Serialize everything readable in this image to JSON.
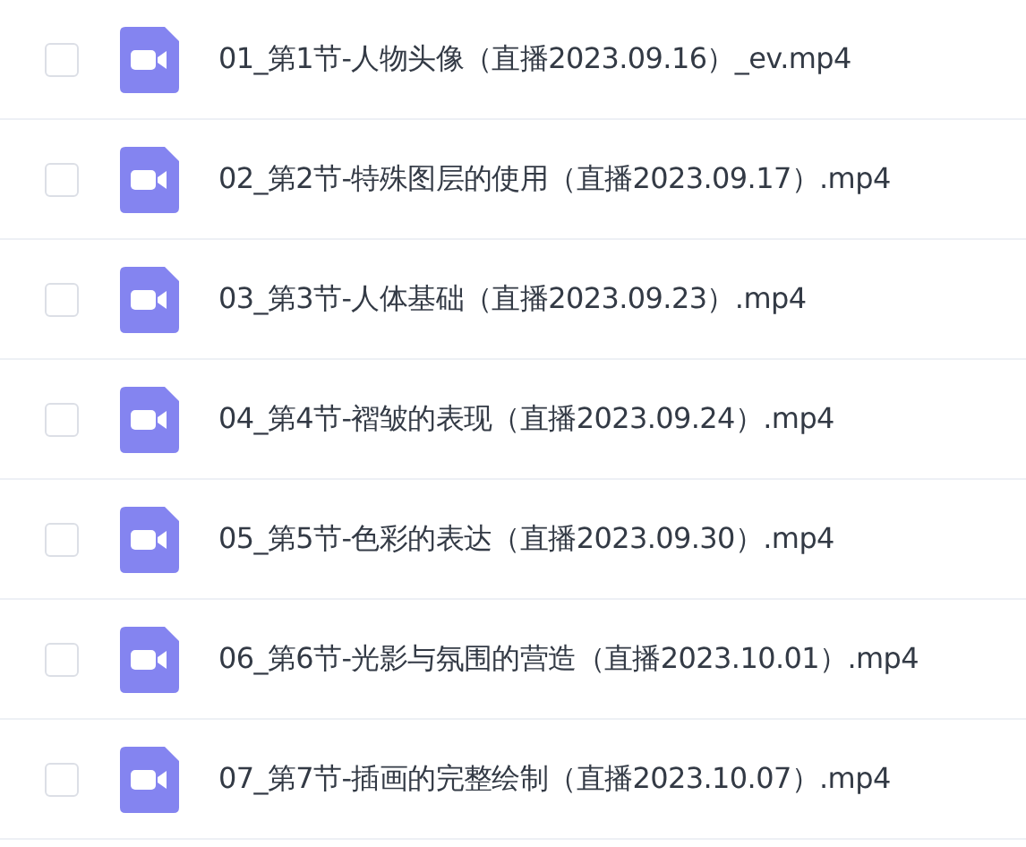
{
  "files": [
    {
      "name": "01_第1节-人物头像（直播2023.09.16）_ev.mp4",
      "checked": false
    },
    {
      "name": "02_第2节-特殊图层的使用（直播2023.09.17）.mp4",
      "checked": false
    },
    {
      "name": "03_第3节-人体基础（直播2023.09.23）.mp4",
      "checked": false
    },
    {
      "name": "04_第4节-褶皱的表现（直播2023.09.24）.mp4",
      "checked": false
    },
    {
      "name": "05_第5节-色彩的表达（直播2023.09.30）.mp4",
      "checked": false
    },
    {
      "name": "06_第6节-光影与氛围的营造（直播2023.10.01）.mp4",
      "checked": false
    },
    {
      "name": "07_第7节-插画的完整绘制（直播2023.10.07）.mp4",
      "checked": false
    }
  ]
}
